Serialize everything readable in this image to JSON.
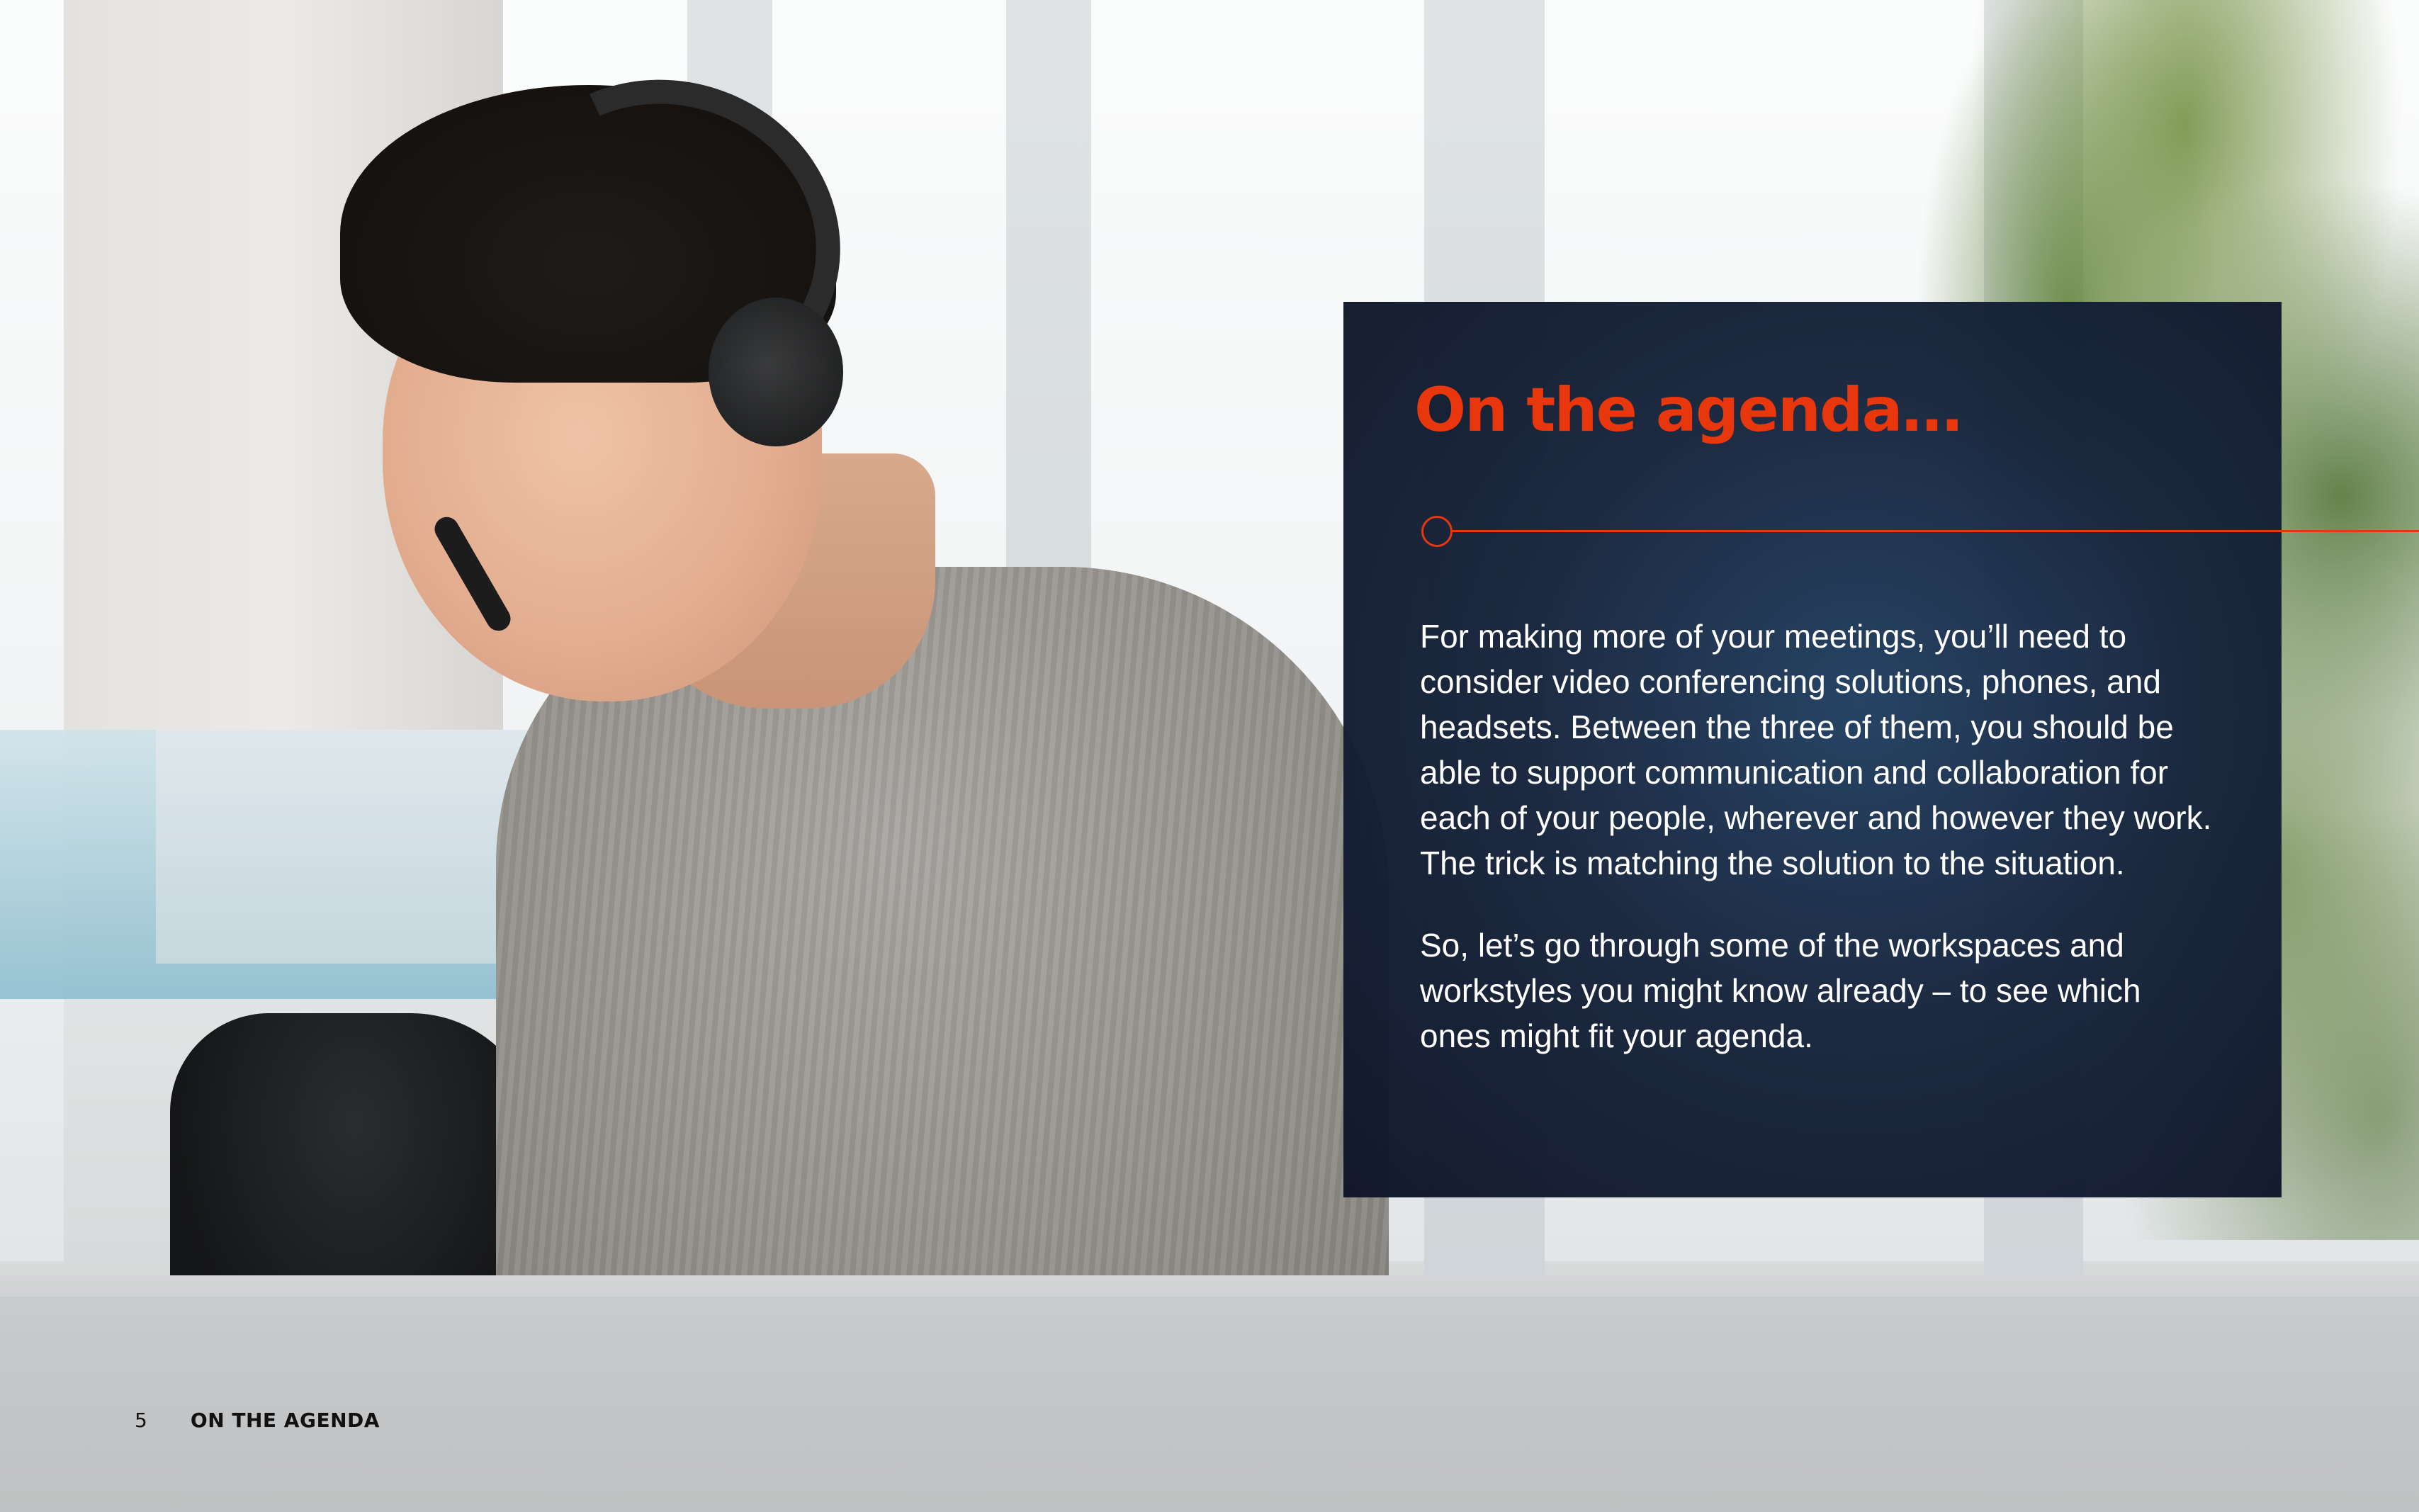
{
  "panel": {
    "title": "On the agenda…",
    "paragraphs": [
      "For making more of your meetings, you’ll need to consider video conferencing solutions, phones, and headsets. Between the three of them, you should be able to support communication and collaboration for each of your people, wherever and however they work. The trick is matching the solution to the situation.",
      "So, let’s go through some of the workspaces and workstyles you might know already – to see which ones might fit your agenda."
    ]
  },
  "footer": {
    "page_number": "5",
    "section_title": "ON THE AGENDA"
  },
  "colors": {
    "accent": "#e8360d",
    "panel_background": "#16243c",
    "body_text": "#ffffff"
  }
}
